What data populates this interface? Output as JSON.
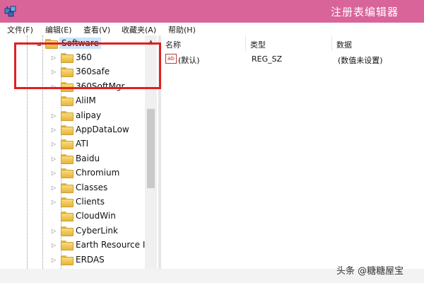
{
  "window": {
    "title": "注册表编辑器"
  },
  "menu": [
    {
      "label": "文件(F)"
    },
    {
      "label": "编辑(E)"
    },
    {
      "label": "查看(V)"
    },
    {
      "label": "收藏夹(A)"
    },
    {
      "label": "帮助(H)"
    }
  ],
  "tree": {
    "root": {
      "label": "Software",
      "expanded": true
    },
    "children": [
      {
        "label": "360",
        "has_children": true
      },
      {
        "label": "360safe",
        "has_children": true
      },
      {
        "label": "360SoftMgr",
        "has_children": true
      },
      {
        "label": "AliIM",
        "has_children": false
      },
      {
        "label": "alipay",
        "has_children": true
      },
      {
        "label": "AppDataLow",
        "has_children": true
      },
      {
        "label": "ATI",
        "has_children": true
      },
      {
        "label": "Baidu",
        "has_children": true
      },
      {
        "label": "Chromium",
        "has_children": true
      },
      {
        "label": "Classes",
        "has_children": true
      },
      {
        "label": "Clients",
        "has_children": true
      },
      {
        "label": "CloudWin",
        "has_children": false
      },
      {
        "label": "CyberLink",
        "has_children": true
      },
      {
        "label": "Earth Resource I",
        "has_children": true
      },
      {
        "label": "ERDAS",
        "has_children": true
      }
    ]
  },
  "list": {
    "columns": [
      {
        "label": "名称"
      },
      {
        "label": "类型"
      },
      {
        "label": "数据"
      }
    ],
    "rows": [
      {
        "name": "(默认)",
        "type": "REG_SZ",
        "data": "(数值未设置)",
        "icon": "ab"
      }
    ]
  },
  "watermark": "头条 @糖糖屋宝",
  "colors": {
    "background": "#d9649a",
    "highlight": "#e0201f",
    "selection": "#cce6fb",
    "folder": "#f2c84b"
  }
}
